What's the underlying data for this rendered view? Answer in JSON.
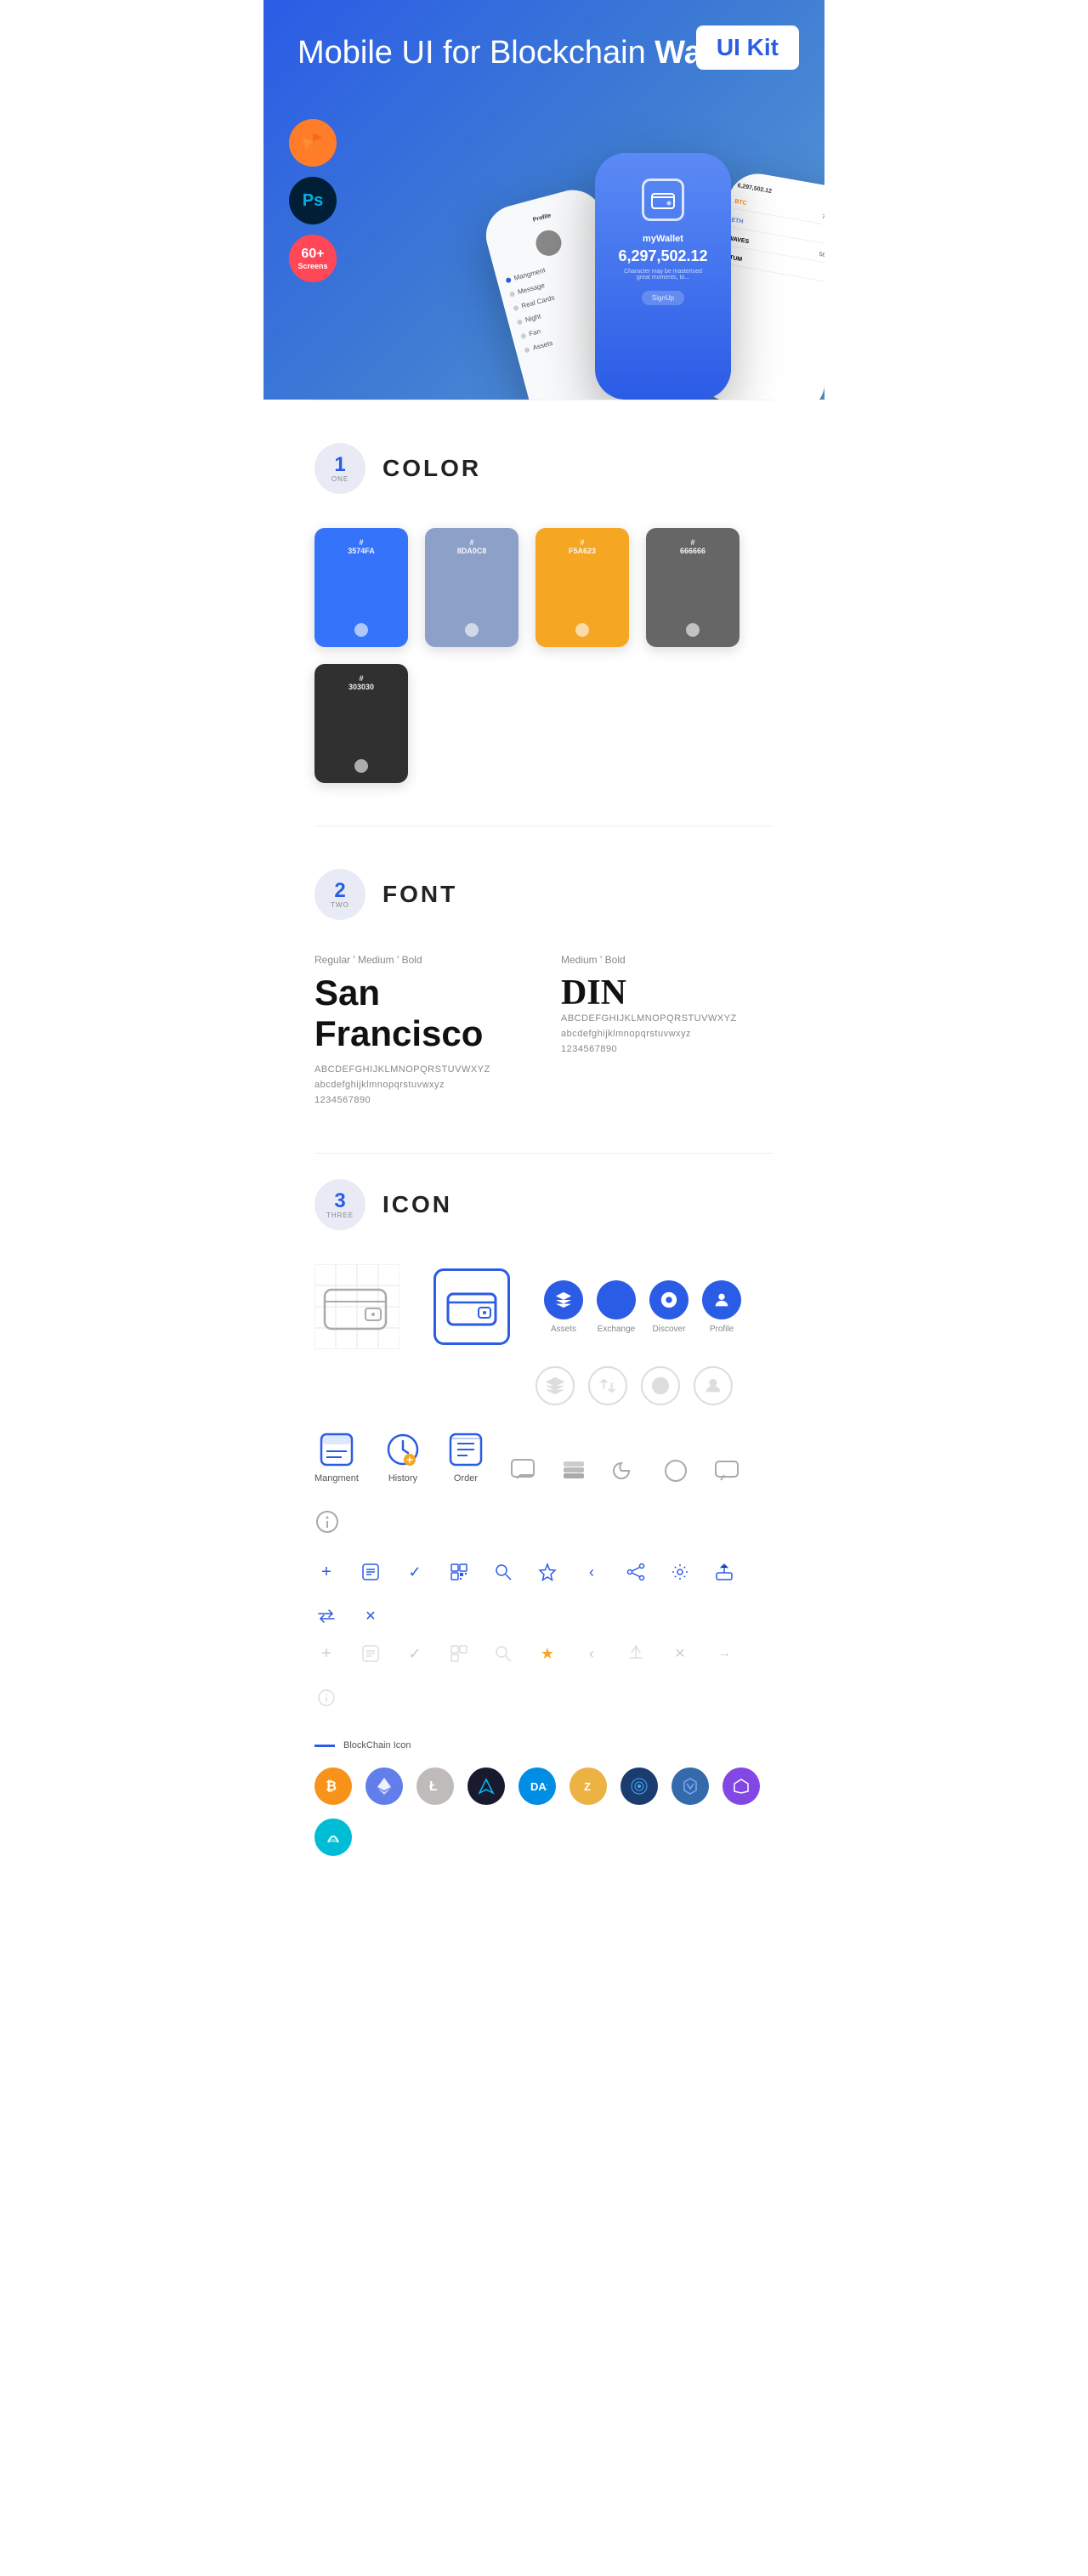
{
  "hero": {
    "title_normal": "Mobile UI for Blockchain ",
    "title_bold": "Wallet",
    "badge": "UI Kit",
    "badge_sketch": "Sketch",
    "badge_ps": "Ps",
    "badge_screens": "60+\nScreens"
  },
  "sections": {
    "color": {
      "number": "1",
      "word": "ONE",
      "title": "COLOR",
      "colors": [
        {
          "hex": "#3574FA",
          "code": "#\n3574FA"
        },
        {
          "hex": "#8DA0C8",
          "code": "#\n8DA0C8"
        },
        {
          "hex": "#F5A623",
          "code": "#\nF5A623"
        },
        {
          "hex": "#666666",
          "code": "#\n666666"
        },
        {
          "hex": "#303030",
          "code": "#\n303030"
        }
      ]
    },
    "font": {
      "number": "2",
      "word": "TWO",
      "title": "FONT",
      "font1": {
        "style": "Regular ' Medium ' Bold",
        "name": "San Francisco",
        "upper": "ABCDEFGHIJKLMNOPQRSTUVWXYZ",
        "lower": "abcdefghijklmnopqrstuvwxyz",
        "nums": "1234567890"
      },
      "font2": {
        "style": "Medium ' Bold",
        "name": "DIN",
        "upper": "ABCDEFGHIJKLMNOPQRSTUVWXYZ",
        "lower": "abcdefghijklmnopqrstuvwxyz",
        "nums": "1234567890"
      }
    },
    "icon": {
      "number": "3",
      "word": "THREE",
      "title": "ICON",
      "nav_icons": [
        {
          "label": "Assets"
        },
        {
          "label": "Exchange"
        },
        {
          "label": "Discover"
        },
        {
          "label": "Profile"
        }
      ],
      "bottom_icons": [
        {
          "label": "Mangment"
        },
        {
          "label": "History"
        },
        {
          "label": "Order"
        }
      ],
      "blockchain_label": "BlockChain Icon",
      "cryptos": [
        {
          "label": "BTC",
          "color": "#f7931a"
        },
        {
          "label": "ETH",
          "color": "#627eea"
        },
        {
          "label": "LTC",
          "color": "#bfbbbb"
        },
        {
          "label": "WINGS",
          "color": "#1a1a2e"
        },
        {
          "label": "DASH",
          "color": "#008de4"
        },
        {
          "label": "ZEC",
          "color": "#ecb244"
        },
        {
          "label": "NET",
          "color": "#1a3c6e"
        },
        {
          "label": "XRP",
          "color": "#346aa9"
        },
        {
          "label": "POL",
          "color": "#8247e5"
        },
        {
          "label": "SKY",
          "color": "#00bcd4"
        }
      ]
    }
  }
}
